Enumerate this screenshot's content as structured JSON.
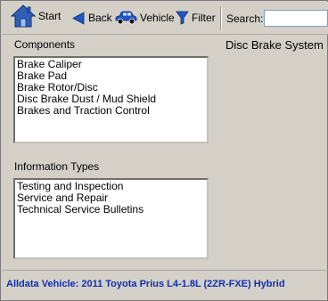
{
  "toolbar": {
    "start_label": "Start",
    "back_label": "Back",
    "vehicle_label": "Vehicle",
    "filter_label": "Filter",
    "search_label": "Search:",
    "search_value": ""
  },
  "components": {
    "label": "Components",
    "items": [
      {
        "label": "Brake Caliper"
      },
      {
        "label": "Brake Pad"
      },
      {
        "label": "Brake Rotor/Disc"
      },
      {
        "label": "Disc Brake Dust / Mud Shield"
      },
      {
        "label": "Brakes and Traction Control"
      }
    ]
  },
  "information_types": {
    "label": "Information Types",
    "items": [
      {
        "label": "Testing and Inspection"
      },
      {
        "label": "Service and Repair"
      },
      {
        "label": "Technical Service Bulletins"
      }
    ]
  },
  "system_title": "Disc Brake System",
  "footer": {
    "vehicle_text": "Alldata Vehicle: 2011 Toyota Prius L4-1.8L (2ZR-FXE) Hybrid"
  },
  "colors": {
    "background": "#d4d0c8",
    "footer_text": "#0f2fb4",
    "icon_blue": "#1f56c9"
  }
}
